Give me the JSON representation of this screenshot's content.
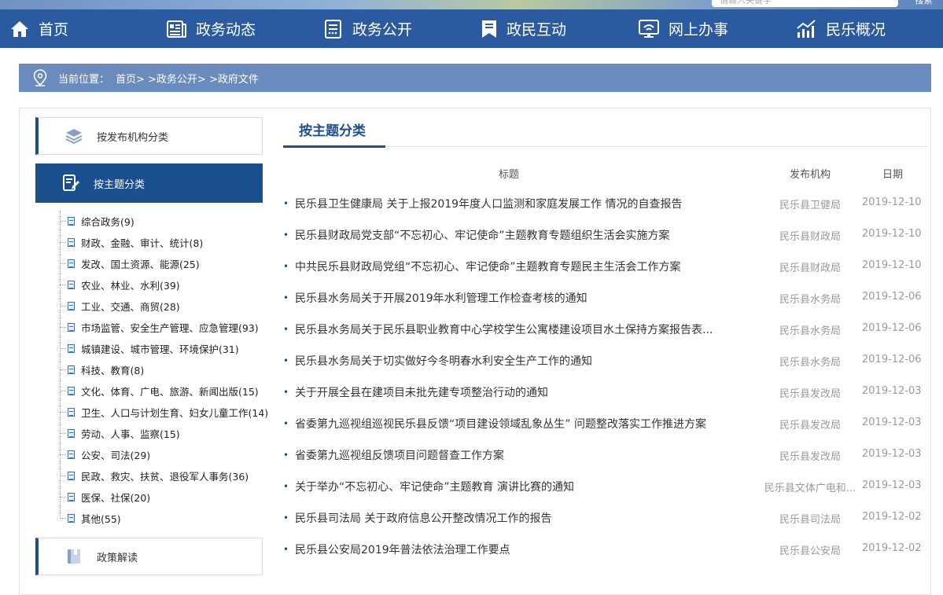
{
  "top": {
    "search_placeholder": "请输入关键字",
    "search_button": "搜索"
  },
  "nav": [
    {
      "label": "首页",
      "icon": "home-icon"
    },
    {
      "label": "政务动态",
      "icon": "news-icon"
    },
    {
      "label": "政务公开",
      "icon": "document-list-icon"
    },
    {
      "label": "政民互动",
      "icon": "bookmark-icon"
    },
    {
      "label": "网上办事",
      "icon": "monitor-icon"
    },
    {
      "label": "民乐概况",
      "icon": "chart-icon"
    }
  ],
  "breadcrumb": {
    "prefix": "当前位置：",
    "path": "首页> >政务公开> >政府文件"
  },
  "sidebar": {
    "tab_org": "按发布机构分类",
    "tab_topic": "按主题分类",
    "tab_policy": "政策解读",
    "topics": [
      "综合政务(9)",
      "财政、金融、审计、统计(8)",
      "发改、国土资源、能源(25)",
      "农业、林业、水利(39)",
      "工业、交通、商贸(28)",
      "市场监管、安全生产管理、应急管理(93)",
      "城镇建设、城市管理、环境保护(31)",
      "科技、教育(8)",
      "文化、体育、广电、旅游、新闻出版(15)",
      "卫生、人口与计划生育、妇女儿童工作(14)",
      "劳动、人事、监察(15)",
      "公安、司法(29)",
      "民政、救灾、扶贫、退役军人事务(36)",
      "医保、社保(20)",
      "其他(55)"
    ]
  },
  "main": {
    "title": "按主题分类",
    "col_title": "标题",
    "col_org": "发布机构",
    "col_date": "日期",
    "rows": [
      {
        "title": "民乐县卫生健康局 关于上报2019年度人口监测和家庭发展工作 情况的自查报告",
        "org": "民乐县卫健局",
        "date": "2019-12-10"
      },
      {
        "title": "民乐县财政局党支部“不忘初心、牢记使命”主题教育专题组织生活会实施方案",
        "org": "民乐县财政局",
        "date": "2019-12-10"
      },
      {
        "title": "中共民乐县财政局党组“不忘初心、牢记使命”主题教育专题民主生活会工作方案",
        "org": "民乐县财政局",
        "date": "2019-12-10"
      },
      {
        "title": "民乐县水务局关于开展2019年水利管理工作检查考核的通知",
        "org": "民乐县水务局",
        "date": "2019-12-06"
      },
      {
        "title": "民乐县水务局关于民乐县职业教育中心学校学生公寓楼建设项目水土保持方案报告表...",
        "org": "民乐县水务局",
        "date": "2019-12-06"
      },
      {
        "title": "民乐县水务局关于切实做好今冬明春水利安全生产工作的通知",
        "org": "民乐县水务局",
        "date": "2019-12-06"
      },
      {
        "title": "关于开展全县在建项目未批先建专项整治行动的通知",
        "org": "民乐县发改局",
        "date": "2019-12-03"
      },
      {
        "title": "省委第九巡视组巡视民乐县反馈“项目建设领域乱象丛生” 问题整改落实工作推进方案",
        "org": "民乐县发改局",
        "date": "2019-12-03"
      },
      {
        "title": "省委第九巡视组反馈项目问题督查工作方案",
        "org": "民乐县发改局",
        "date": "2019-12-03"
      },
      {
        "title": "关于举办“不忘初心、牢记使命”主题教育 演讲比赛的通知",
        "org": "民乐县文体广电和...",
        "date": "2019-12-03"
      },
      {
        "title": "民乐县司法局 关于政府信息公开整改情况工作的报告",
        "org": "民乐县司法局",
        "date": "2019-12-02"
      },
      {
        "title": "民乐县公安局2019年普法依法治理工作要点",
        "org": "民乐县公安局",
        "date": "2019-12-02"
      }
    ]
  },
  "colors": {
    "nav_bg": "#2a5aa0",
    "crumb_bg": "#6a8bbd",
    "accent": "#1c4f8f"
  }
}
